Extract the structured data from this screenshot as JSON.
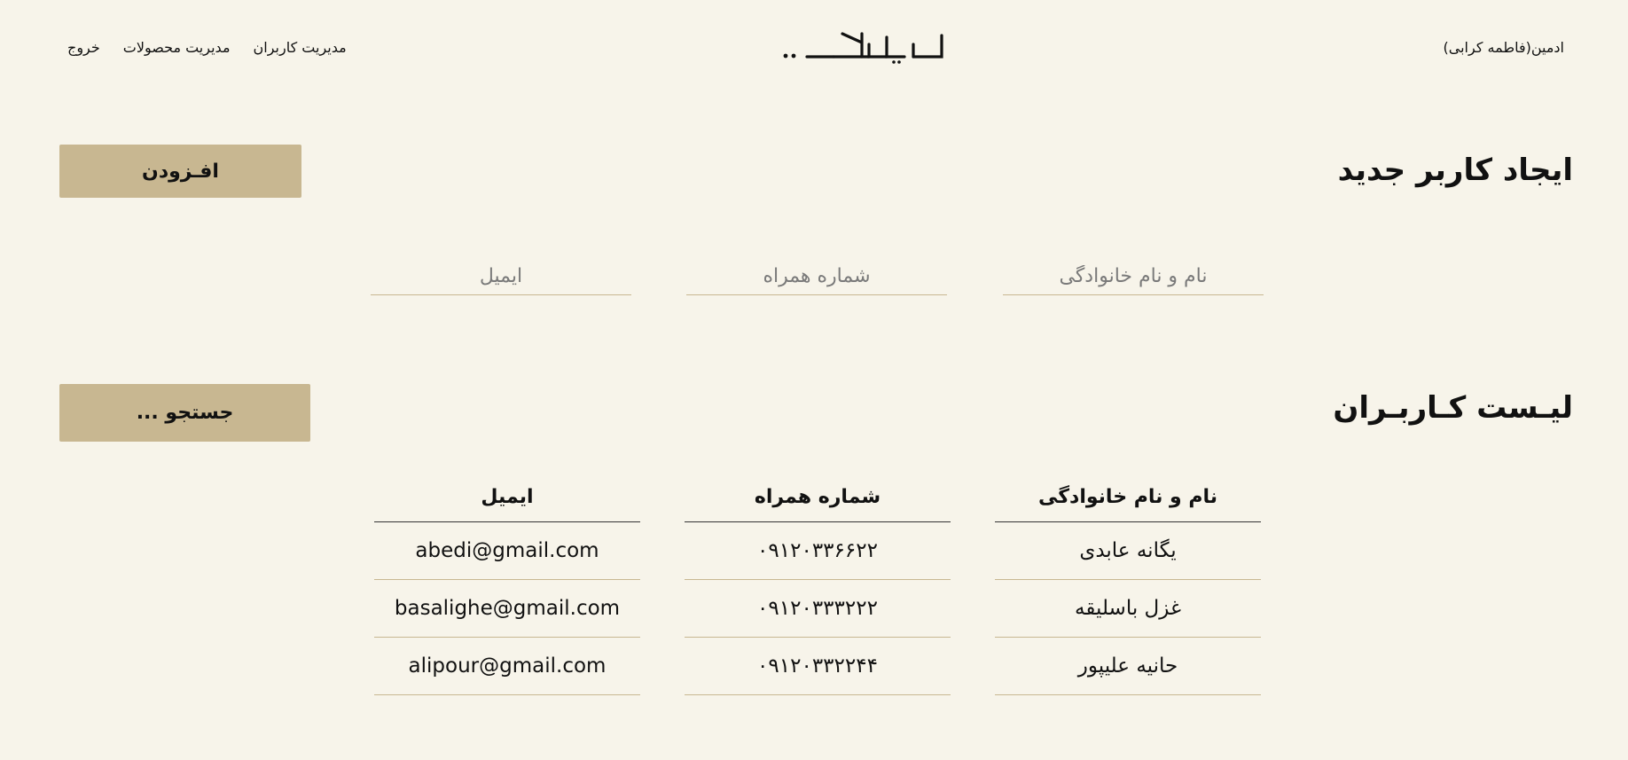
{
  "header": {
    "admin_label": "ادمین(فاطمه کرابی)",
    "logo_text": "لــایـلــاکـــ..",
    "nav": {
      "users": "مدیریت کاربران",
      "products": "مدیریت محصولات",
      "logout": "خروج"
    }
  },
  "create_user": {
    "title": "ایجاد کاربر جدید",
    "add_button": "افـزودن",
    "fields": {
      "fullname_placeholder": "نام و نام خانوادگی",
      "phone_placeholder": "شماره همراه",
      "email_placeholder": "ایمیل"
    }
  },
  "user_list": {
    "title": "لیـست کـاربـران",
    "search_button": "جستجو ...",
    "columns": {
      "fullname": "نام و نام خانوادگی",
      "phone": "شماره همراه",
      "email": "ایمیل"
    },
    "rows": [
      {
        "fullname": "یگانه عابدی",
        "phone": "۰۹۱۲۰۳۳۶۶۲۲",
        "email": "abedi@gmail.com"
      },
      {
        "fullname": "غزل باسلیقه",
        "phone": "۰۹۱۲۰۳۳۳۲۲۲",
        "email": "basalighe@gmail.com"
      },
      {
        "fullname": "حانیه علیپور",
        "phone": "۰۹۱۲۰۳۳۲۲۴۴",
        "email": "alipour@gmail.com"
      }
    ]
  },
  "colors": {
    "background": "#f7f4ea",
    "accent": "#c8b791",
    "text": "#111111"
  }
}
